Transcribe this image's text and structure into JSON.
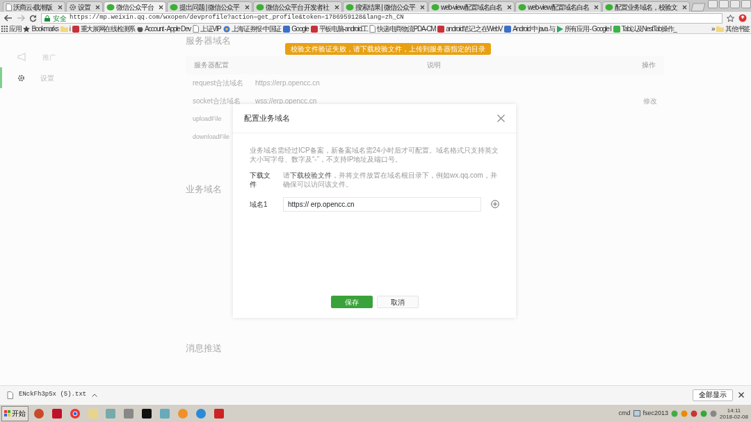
{
  "browser": {
    "tabs": [
      {
        "title": "沃商云-载潮版",
        "kind": "page",
        "selected": false
      },
      {
        "title": "设置",
        "kind": "settings",
        "selected": false
      },
      {
        "title": "微信公众平台",
        "kind": "wechat",
        "selected": true
      },
      {
        "title": "提出问题 | 微信公众平",
        "kind": "wechat",
        "selected": false
      },
      {
        "title": "微信公众平台 开发者社",
        "kind": "wechat",
        "selected": false
      },
      {
        "title": "搜索结果 | 微信公众平",
        "kind": "wechat",
        "selected": false
      },
      {
        "title": "web-view配置域名白名",
        "kind": "wechat",
        "selected": false
      },
      {
        "title": "web-view配置域名白名",
        "kind": "wechat",
        "selected": false
      },
      {
        "title": "配置业务域名，校验文",
        "kind": "wechat",
        "selected": false
      }
    ],
    "address": {
      "security": "安全",
      "url": "https://mp.weixin.qq.com/wxopen/devprofile?action=get_profile&token=1786959128&lang=zh_CN"
    },
    "bookmarks": [
      {
        "label": "应用",
        "kind": "apps"
      },
      {
        "label": "Bookmarks",
        "kind": "star"
      },
      {
        "label": "i",
        "kind": "folder"
      },
      {
        "label": "重大展网在线检测系",
        "kind": "red"
      },
      {
        "label": "Account - Apple Dev",
        "kind": "apple"
      },
      {
        "label": "上证VIP",
        "kind": "page"
      },
      {
        "label": "上海证券报·中国证",
        "kind": "swirl"
      },
      {
        "label": "Google",
        "kind": "blue"
      },
      {
        "label": "平板电脑-android工",
        "kind": "red"
      },
      {
        "label": "快递电商物流PDA-CM",
        "kind": "page"
      },
      {
        "label": "android笔记之在WebV",
        "kind": "red"
      },
      {
        "label": "Android 中 java 与",
        "kind": "blue"
      },
      {
        "label": "所有应用 - Google I",
        "kind": "play"
      },
      {
        "label": "Tab以及NestTab操作_",
        "kind": "green"
      }
    ],
    "overflow": "»",
    "other_bookmarks": "其他书签"
  },
  "page": {
    "sidebar": [
      {
        "label": "推广",
        "kind": "megaphone",
        "selected": false
      },
      {
        "label": "设置",
        "kind": "settings",
        "selected": true
      }
    ],
    "server_domain": {
      "title": "服务器域名",
      "toast": "校验文件验证失败，请下载校验文件，上传到服务器指定的目录",
      "columns": [
        "服务器配置",
        "说明",
        "操作"
      ],
      "rows": [
        {
          "name": "request合法域名",
          "value": "https://erp.opencc.cn"
        },
        {
          "name": "socket合法域名",
          "value": "wss://erp.opencc.cn"
        },
        {
          "name": "uploadFile",
          "value": ""
        },
        {
          "name": "downloadFile",
          "value": ""
        }
      ],
      "action": "修改"
    },
    "business_domain_title": "业务域名",
    "message_push_title": "消息推送"
  },
  "dialog": {
    "title": "配置业务域名",
    "notice": "业务域名需经过ICP备案，新备案域名需24小时后才可配置。域名格式只支持英文大小写字母、数字及“-”，不支持IP地址及端口号。",
    "download_label": "下载文件",
    "download_prefix": "请",
    "download_link": "下载校验文件",
    "download_rest": "，并将文件放置在域名根目录下，例如wx.qq.com，并确保可以访问该文件。",
    "domain_label": "域名1",
    "domain_value": "https:// erp.opencc.cn",
    "buttons": [
      {
        "label": "保存",
        "kind": "primary"
      },
      {
        "label": "取消",
        "kind": "secondary"
      }
    ]
  },
  "downloads": {
    "file": "ENckFh3p5x (5).txt",
    "show_all": "全部显示"
  },
  "taskbar": {
    "start": "开始",
    "tasks": [
      "cmd",
      "fsec2013"
    ],
    "time": "14:11",
    "date": "2018-02-08"
  }
}
